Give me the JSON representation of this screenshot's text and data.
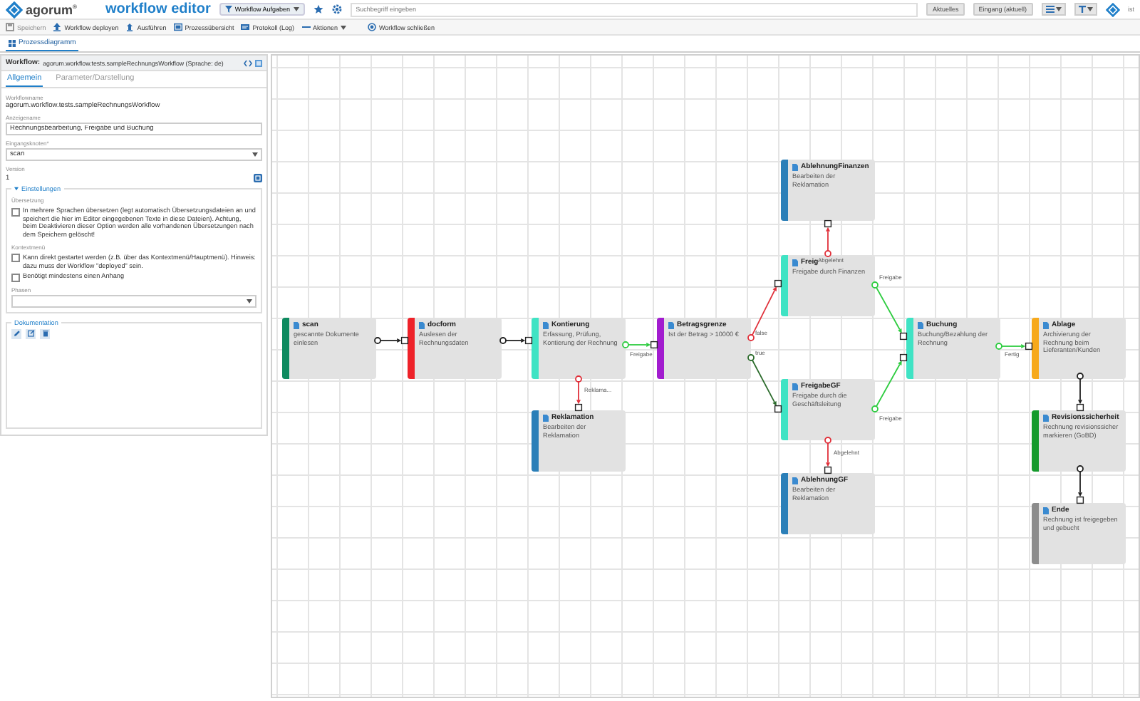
{
  "header": {
    "logo": "agorum$^{®}$",
    "title": "workflow editor",
    "menu_button": "Workflow Aufgaben",
    "search": {
      "placeholder": "Suchbegriff eingeben"
    },
    "buttons": [
      "Aktuelles",
      "Eingang (aktuell)"
    ],
    "user": "ist"
  },
  "toolbar": [
    {
      "kind": "save",
      "label": "Speichern",
      "disabled": true
    },
    {
      "kind": "deploy",
      "label": "Workflow deployen",
      "disabled": false
    },
    {
      "kind": "run",
      "label": "Ausführen",
      "disabled": false
    },
    {
      "kind": "overview",
      "label": "Prozessübersicht",
      "disabled": false
    },
    {
      "kind": "log",
      "label": "Protokoll (Log)",
      "disabled": false
    },
    {
      "kind": "menu",
      "label": "Aktionen",
      "disabled": false
    },
    {
      "kind": "close",
      "label": "Workflow schließen",
      "disabled": false
    }
  ],
  "tabs": [
    {
      "label": "Prozessdiagramm",
      "selected": true
    }
  ],
  "panel": {
    "title": "Workflow:",
    "subtitle": "agorum.workflow.tests.sampleRechnungsWorkflow (Sprache: de)",
    "tabs": [
      {
        "label": "Allgemein",
        "selected": true
      },
      {
        "label": "Parameter/Darstellung",
        "selected": false
      }
    ],
    "fields": [
      {
        "kind": "text",
        "label": "Workflowname",
        "value": "agorum.workflow.tests.sampleRechnungsWorkflow"
      },
      {
        "kind": "input",
        "label": "Anzeigename",
        "value": "Rechnungsbearbeitung, Freigabe und Buchung"
      },
      {
        "kind": "select",
        "label": "Eingangsknoten*",
        "value": "scan"
      },
      {
        "kind": "version",
        "label": "Version",
        "value": "1"
      }
    ],
    "settings": {
      "legend": "Einstellungen",
      "expanded": true,
      "groups": [
        {
          "label": "Übersetzung",
          "checkboxes": [
            {
              "text": "In mehrere Sprachen übersetzen (legt automatisch Übersetzungsdateien an und speichert die hier im Editor eingegebenen Texte in diese Dateien). Achtung, beim Deaktivieren dieser Option werden alle vorhandenen Übersetzungen nach dem Speichern gelöscht!",
              "checked": false
            }
          ]
        },
        {
          "label": "Kontextmenü",
          "checkboxes": [
            {
              "text": "Kann direkt gestartet werden (z.B. über das Kontextmenü/Hauptmenü). Hinweis: dazu muss der Workflow \"deployed\" sein.",
              "checked": false
            },
            {
              "text": "Benötigt mindestens einen Anhang",
              "checked": false
            }
          ]
        }
      ],
      "phases": {
        "label": "Phasen"
      }
    },
    "documentation": {
      "legend": "Dokumentation"
    }
  },
  "diagram": {
    "nodes": [
      {
        "title": "scan",
        "description": "gescannte Dokumente einlesen",
        "color": "#0e8a5f"
      },
      {
        "title": "docform",
        "description": "Auslesen der Rechnungsdaten",
        "color": "#ee2229"
      },
      {
        "title": "Kontierung",
        "description": "Erfassung, Prüfung, Kontierung der Rechnung",
        "color": "#3fe3c4"
      },
      {
        "title": "Betragsgrenze",
        "description": "Ist der Betrag > 10000 €",
        "color": "#a21ccf"
      },
      {
        "title": "AblehnungFinanzen",
        "description": "Bearbeiten der Reklamation",
        "color": "#2b7fb8"
      },
      {
        "title": "Freig",
        "description": "Freigabe durch Finanzen",
        "color": "#3fe3c4"
      },
      {
        "title": "FreigabeGF",
        "description": "Freigabe durch die Geschäftsleitung",
        "color": "#3fe3c4"
      },
      {
        "title": "AblehnungGF",
        "description": "Bearbeiten der Reklamation",
        "color": "#2b7fb8"
      },
      {
        "title": "Reklamation",
        "description": "Bearbeiten der Reklamation",
        "color": "#2b7fb8"
      },
      {
        "title": "Buchung",
        "description": "Buchung/Bezahlung der Rechnung",
        "color": "#3fe3c4"
      },
      {
        "title": "Ablage",
        "description": "Archivierung der Rechnung beim Lieferanten/Kunden",
        "color": "#f7a91b"
      },
      {
        "title": "Revisionssicherheit",
        "description": "Rechnung revisionssicher markieren (GoBD)",
        "color": "#159a2c"
      },
      {
        "title": "Ende",
        "description": "Rechnung ist freigegeben und gebucht",
        "color": "#8c8c8c"
      }
    ],
    "edges": [
      {
        "color": "#222222"
      },
      {
        "color": "#222222"
      },
      {
        "label": "Freigabe",
        "color": "#2ecc40"
      },
      {
        "label": "Reklama...",
        "color": "#e0303a"
      },
      {
        "label": "false",
        "color": "#e0303a"
      },
      {
        "label": "true",
        "color": "#2b6b2b"
      },
      {
        "label": "Abgelehnt",
        "color": "#e0303a"
      },
      {
        "label": "Freigabe",
        "color": "#2ecc40"
      },
      {
        "label": "Abgelehnt",
        "color": "#e0303a"
      },
      {
        "label": "Freigabe",
        "color": "#2ecc40"
      },
      {
        "label": "Fertig",
        "color": "#2ecc40"
      },
      {
        "color": "#222222"
      },
      {
        "color": "#222222"
      }
    ]
  }
}
